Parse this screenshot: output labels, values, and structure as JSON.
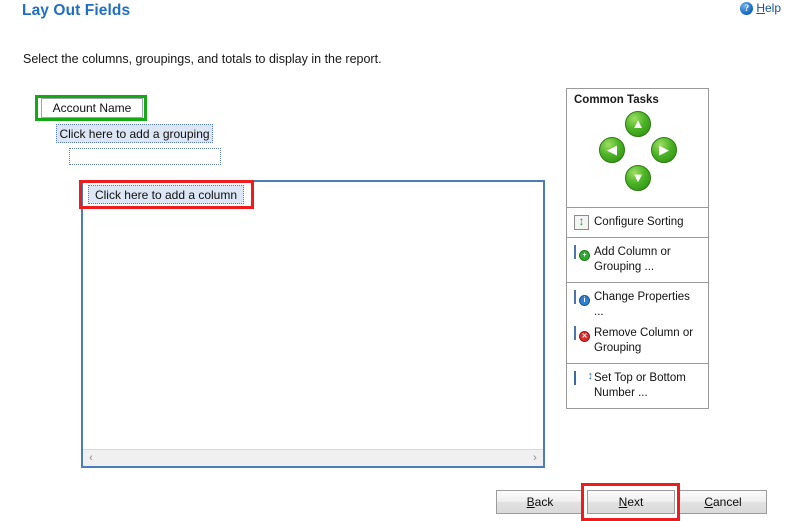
{
  "header": {
    "title": "Lay Out Fields",
    "help": {
      "icon": "help-circle-icon",
      "accel": "H",
      "rest": "elp"
    }
  },
  "subtitle": "Select the columns, groupings, and totals to display in the report.",
  "grouping_area": {
    "account_name_label": "Account Name",
    "add_grouping_label": "Click here to add a grouping",
    "empty_grouping_label": ""
  },
  "column_panel": {
    "add_column_label": "Click here to add a column",
    "scroll_left_glyph": "‹",
    "scroll_right_glyph": "›"
  },
  "common_tasks": {
    "title": "Common Tasks",
    "nav_buttons": [
      {
        "name": "move-up-button",
        "glyph": "▲"
      },
      {
        "name": "move-left-button",
        "glyph": "◀"
      },
      {
        "name": "move-right-button",
        "glyph": "▶"
      },
      {
        "name": "move-down-button",
        "glyph": "▼"
      }
    ],
    "groups": [
      {
        "items": [
          {
            "icon": "configure-sorting-icon",
            "label": "Configure Sorting"
          }
        ]
      },
      {
        "items": [
          {
            "icon": "add-column-or-grouping-icon",
            "label": "Add Column or Grouping ..."
          }
        ]
      },
      {
        "items": [
          {
            "icon": "change-properties-icon",
            "label": "Change Properties ..."
          },
          {
            "icon": "remove-column-or-grouping-icon",
            "label": "Remove Column or Grouping"
          }
        ]
      },
      {
        "items": [
          {
            "icon": "set-top-or-bottom-number-icon",
            "label": "Set Top or Bottom Number ..."
          }
        ]
      }
    ]
  },
  "footer": {
    "back": {
      "accel": "B",
      "rest": "ack"
    },
    "next": {
      "pre": "N",
      "accel": "N",
      "rest": "ext"
    },
    "cancel": {
      "accel": "C",
      "rest": "ancel"
    }
  },
  "annotations": {
    "green_box_color": "#16a916",
    "red_box_color": "#ee1c1c"
  }
}
